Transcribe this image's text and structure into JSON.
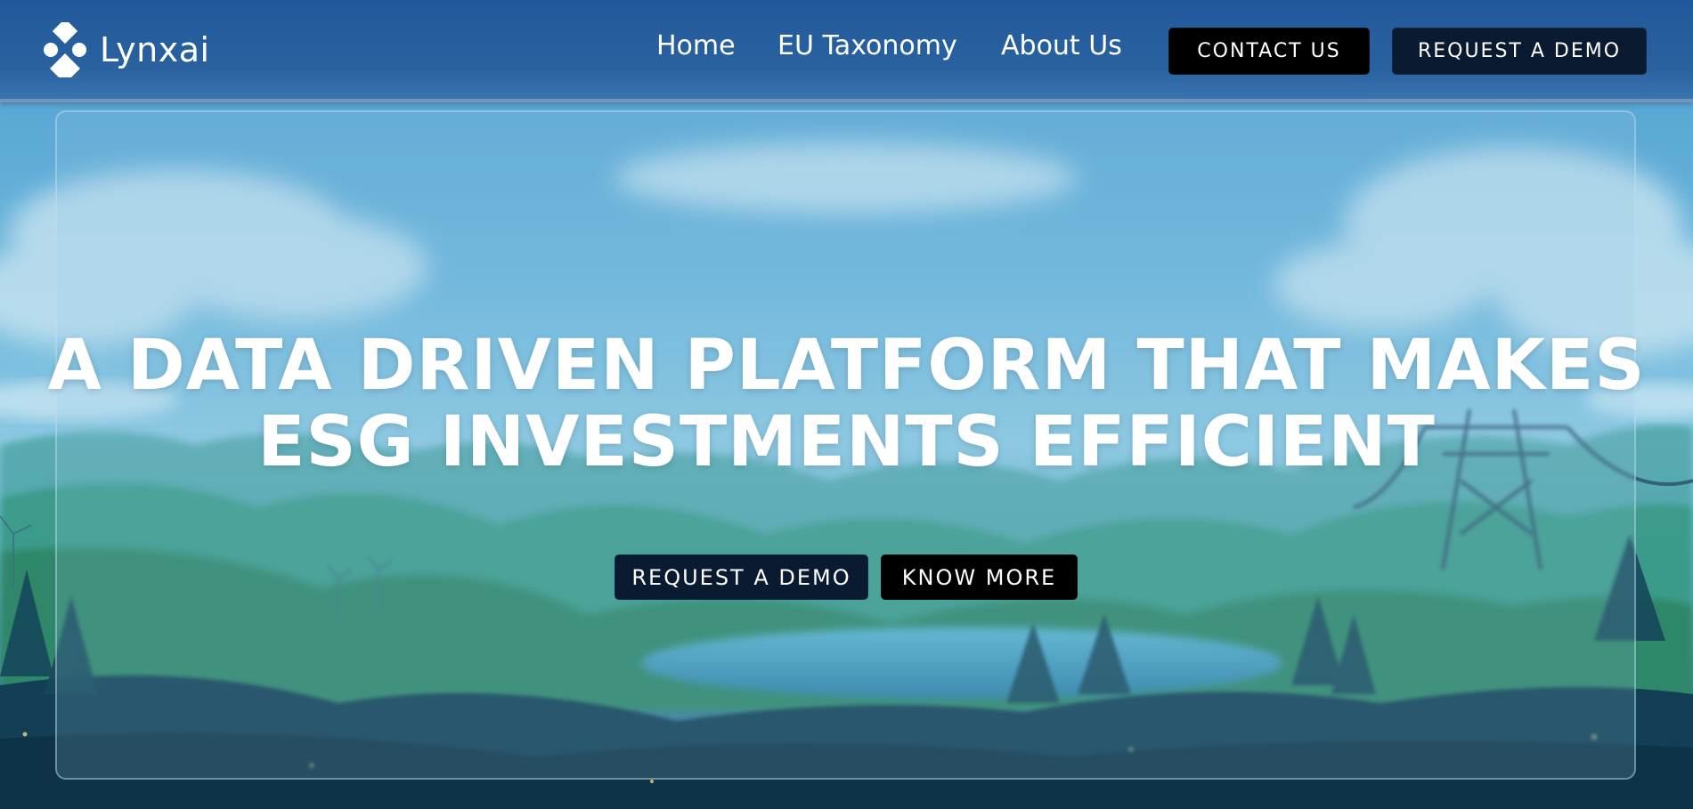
{
  "brand": {
    "name": "Lynxai"
  },
  "nav": {
    "home": "Home",
    "eu_taxonomy": "EU Taxonomy",
    "about": "About Us"
  },
  "header_buttons": {
    "contact": "CONTACT US",
    "request_demo": "REQUEST A DEMO"
  },
  "hero": {
    "title_line1": "A DATA DRIVEN PLATFORM THAT MAKES",
    "title_line2": "ESG INVESTMENTS EFFICIENT",
    "primary_button": "REQUEST A DEMO",
    "secondary_button": "KNOW MORE"
  },
  "colors": {
    "header_bg": "#2a62a0",
    "button_dark": "#0a1a30",
    "button_black": "#000000",
    "text": "#ffffff"
  }
}
